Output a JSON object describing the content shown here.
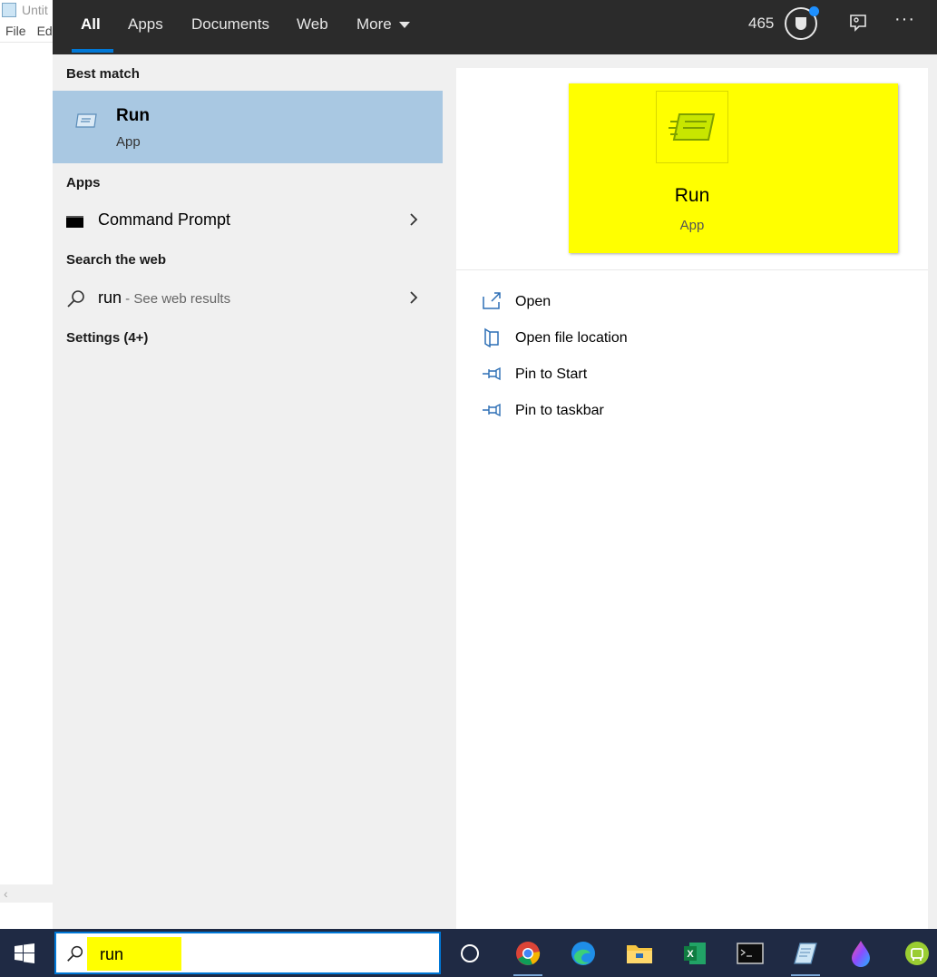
{
  "background_window": {
    "title": "Untit",
    "menu": [
      "File",
      "Ed"
    ],
    "scroll_left": "‹"
  },
  "tabs": [
    {
      "label": "All",
      "active": true
    },
    {
      "label": "Apps"
    },
    {
      "label": "Documents"
    },
    {
      "label": "Web"
    },
    {
      "label": "More"
    }
  ],
  "header": {
    "points": "465",
    "trophy_icon": "trophy-icon",
    "feedback_icon": "feedback-icon",
    "more_options": "···"
  },
  "results": {
    "best_match_heading": "Best match",
    "best_match": {
      "title": "Run",
      "subtitle": "App",
      "icon": "run-icon"
    },
    "apps_heading": "Apps",
    "apps": [
      {
        "label": "Command Prompt",
        "icon": "command-prompt-icon"
      }
    ],
    "web_heading": "Search the web",
    "web": {
      "query": "run",
      "suffix": " - See web results"
    },
    "settings_heading": "Settings (4+)"
  },
  "preview": {
    "title": "Run",
    "subtitle": "App",
    "highlight_color": "#ffff00",
    "actions": [
      {
        "label": "Open",
        "icon": "open-icon"
      },
      {
        "label": "Open file location",
        "icon": "file-location-icon"
      },
      {
        "label": "Pin to Start",
        "icon": "pin-icon"
      },
      {
        "label": "Pin to taskbar",
        "icon": "pin-icon"
      }
    ]
  },
  "taskbar": {
    "search_value": "run",
    "accent": "#0078d7",
    "apps": [
      "cortana",
      "chrome",
      "edge",
      "file-explorer",
      "excel",
      "terminal",
      "notepad",
      "paint",
      "android"
    ]
  }
}
